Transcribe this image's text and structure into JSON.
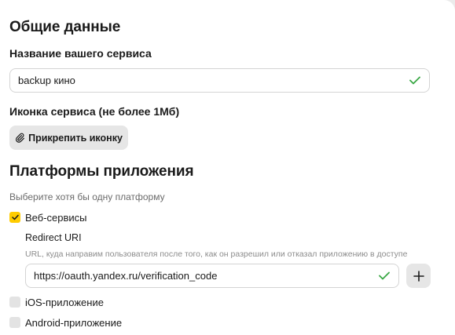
{
  "general": {
    "heading": "Общие данные",
    "service_name_label": "Название вашего сервиса",
    "service_name_value": "backup кино",
    "icon_label": "Иконка сервиса (не более 1Мб)",
    "attach_button": "Прикрепить иконку"
  },
  "platforms": {
    "heading": "Платформы приложения",
    "hint": "Выберите хотя бы одну платформу",
    "items": [
      {
        "label": "Веб-сервисы",
        "checked": true
      },
      {
        "label": "iOS-приложение",
        "checked": false
      },
      {
        "label": "Android-приложение",
        "checked": false
      }
    ],
    "redirect": {
      "label": "Redirect URI",
      "description": "URL, куда направим пользователя после того, как он разрешил или отказал приложению в доступе",
      "value": "https://oauth.yandex.ru/verification_code"
    }
  },
  "icons": {
    "valid": "check-icon",
    "attach": "paperclip-icon",
    "add": "plus-icon",
    "checkbox": "checkmark-icon"
  },
  "colors": {
    "accent": "#ffcc00",
    "valid": "#3aa845",
    "button_bg": "#e6e6e6"
  }
}
